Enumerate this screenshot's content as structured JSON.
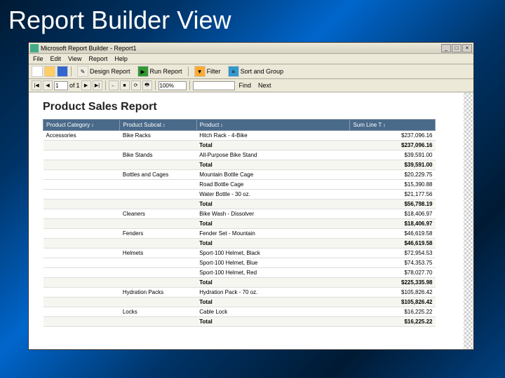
{
  "slide": {
    "title": "Report Builder View"
  },
  "window": {
    "title": "Microsoft Report Builder - Report1"
  },
  "controls": {
    "min": "_",
    "max": "□",
    "close": "×"
  },
  "menu": {
    "file": "File",
    "edit": "Edit",
    "view": "View",
    "report": "Report",
    "help": "Help"
  },
  "toolbar": {
    "design": "Design Report",
    "run": "Run Report",
    "filter": "Filter",
    "sort": "Sort and Group"
  },
  "nav": {
    "first": "|◀",
    "prev": "◀",
    "next": "▶",
    "last": "▶|",
    "page": "1",
    "of_label": "of",
    "total": "1",
    "back": "←",
    "stop": "■",
    "refresh": "⟳",
    "print": "🖶",
    "zoom": "100%",
    "find_label": "Find",
    "next_label": "Next"
  },
  "report": {
    "title": "Product Sales Report",
    "headers": {
      "category": "Product Category",
      "subcategory": "Product Subcat",
      "product": "Product",
      "sales": "Sum Line T"
    },
    "sort_glyph": "↕",
    "data": {
      "category": "Accessories",
      "subcats": [
        {
          "name": "Bike Racks",
          "rows": [
            {
              "product": "Hitch Rack - 4-Bike",
              "amt": "$237,096.16"
            }
          ],
          "total": "$237,096.16"
        },
        {
          "name": "Bike Stands",
          "rows": [
            {
              "product": "All-Purpose Bike Stand",
              "amt": "$39,591.00"
            }
          ],
          "total": "$39,591.00"
        },
        {
          "name": "Bottles and Cages",
          "rows": [
            {
              "product": "Mountain Bottle Cage",
              "amt": "$20,229.75"
            },
            {
              "product": "Road Bottle Cage",
              "amt": "$15,390.88"
            },
            {
              "product": "Water Bottle - 30 oz.",
              "amt": "$21,177.56"
            }
          ],
          "total": "$56,798.19"
        },
        {
          "name": "Cleaners",
          "rows": [
            {
              "product": "Bike Wash - Dissolver",
              "amt": "$18,406.97"
            }
          ],
          "total": "$18,406.97"
        },
        {
          "name": "Fenders",
          "rows": [
            {
              "product": "Fender Set - Mountain",
              "amt": "$46,619.58"
            }
          ],
          "total": "$46,619.58"
        },
        {
          "name": "Helmets",
          "rows": [
            {
              "product": "Sport-100 Helmet, Black",
              "amt": "$72,954.53"
            },
            {
              "product": "Sport-100 Helmet, Blue",
              "amt": "$74,353.75"
            },
            {
              "product": "Sport-100 Helmet, Red",
              "amt": "$78,027.70"
            }
          ],
          "total": "$225,335.98"
        },
        {
          "name": "Hydration Packs",
          "rows": [
            {
              "product": "Hydration Pack - 70 oz.",
              "amt": "$105,826.42"
            }
          ],
          "total": "$105,826.42"
        },
        {
          "name": "Locks",
          "rows": [
            {
              "product": "Cable Lock",
              "amt": "$16,225.22"
            }
          ],
          "total": "$16,225.22"
        }
      ]
    }
  }
}
